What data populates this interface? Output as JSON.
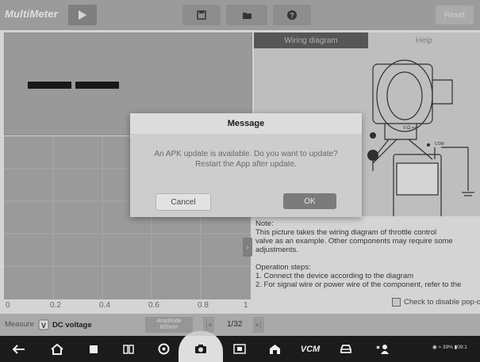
{
  "app": {
    "title": "MultiMeter"
  },
  "toolbar": {
    "reset_label": "Reset"
  },
  "tabs": {
    "wiring": "Wiring diagram",
    "help": "Help"
  },
  "graph": {
    "x_ticks": [
      "0",
      "0.2",
      "0.4",
      "0.6",
      "0.8",
      "1"
    ]
  },
  "notes": {
    "note_title": "Note:",
    "note_lines": [
      "This picture takes the wiring diagram of throttle control",
      "valve as an example. Other components may require some",
      "adjustments."
    ],
    "steps_title": "Operation steps:",
    "steps": [
      "1. Connect the device according to the diagram",
      "2. For signal wire or power wire of the component, refer to the"
    ],
    "checkbox_label": "Check to disable pop-ou"
  },
  "measure": {
    "label": "Measure",
    "mode": "DC voltage",
    "amplitude_title": "Amplitude",
    "amplitude_value": "600mV",
    "page": "1/32"
  },
  "dialog": {
    "title": "Message",
    "line1": "An APK update is available. Do you want to update?",
    "line2": "Restart the App after update.",
    "cancel": "Cancel",
    "ok": "OK"
  },
  "navbar": {
    "vcm_label": "VCM",
    "status_text": "39% ▮09:1"
  },
  "colors": {
    "topbar": "#a9a9a9",
    "navbar": "#1b1b1b",
    "dialog": "#cdcdcd",
    "ok_button": "#7b7b7b"
  }
}
